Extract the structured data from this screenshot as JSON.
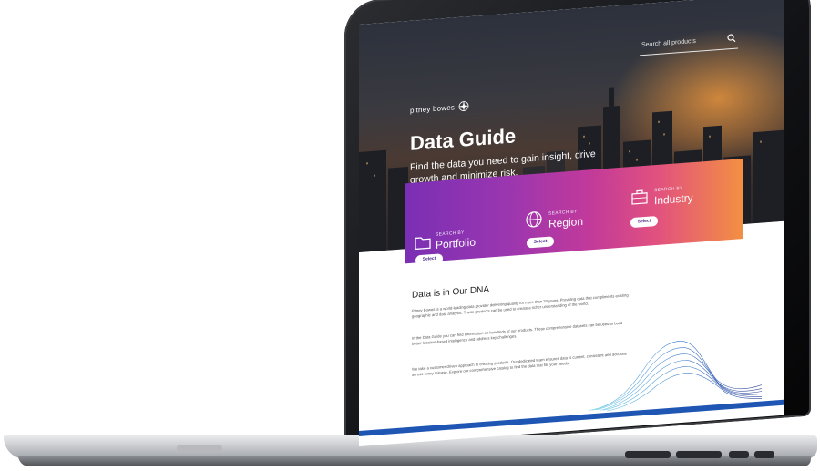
{
  "header": {
    "search_placeholder": "Search all products",
    "logo_text": "pitney bowes"
  },
  "hero": {
    "title": "Data Guide",
    "subtitle": "Find the data you need to gain insight, drive growth and minimize risk."
  },
  "search_cards": [
    {
      "small": "SEARCH BY",
      "label": "Portfolio",
      "button": "Select",
      "icon": "folder-icon"
    },
    {
      "small": "SEARCH BY",
      "label": "Region",
      "button": "Select",
      "icon": "globe-icon"
    },
    {
      "small": "SEARCH BY",
      "label": "Industry",
      "button": "Select",
      "icon": "briefcase-icon"
    }
  ],
  "content": {
    "section_title": "Data is in Our DNA",
    "paragraphs": [
      "Pitney Bowes is a world-leading data provider delivering quality for more than 20 years. Providing data that compliments existing geographic and data analysis. These products can be used to create a richer understanding of the world.",
      "In the Data Guide you can find information on hundreds of our products. These comprehensive datasets can be used to build better location-based intelligence and address key challenges.",
      "We take a customer-driven approach to creating products. Our dedicated team ensures data is current, consistent and accurate across every release. Explore our comprehensive catalog to find the data that fits your needs."
    ]
  },
  "colors": {
    "band_start": "#7a2fb4",
    "band_mid": "#c23a9a",
    "band_end": "#f39042",
    "footer_line": "#1f55b3"
  }
}
